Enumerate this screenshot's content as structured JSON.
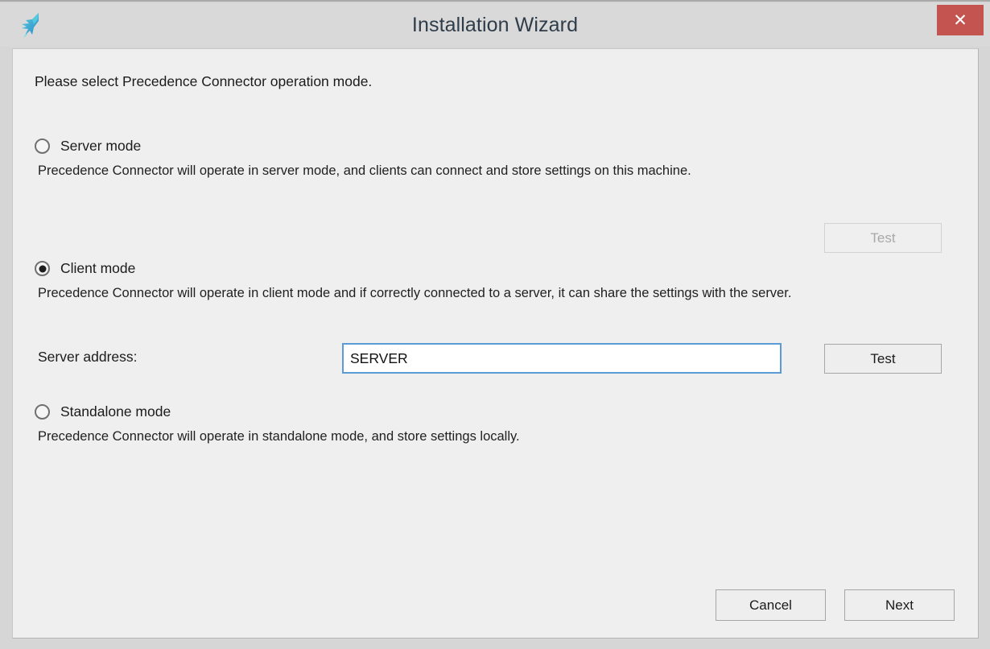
{
  "window": {
    "title": "Installation Wizard",
    "logo_icon": "hummingbird-logo-icon",
    "close_label": "✕",
    "accent_close_color": "#c4544f",
    "focus_border_color": "#5b9bd5",
    "frame_color": "#d6d6d6",
    "panel_color": "#efefef"
  },
  "content": {
    "intro": "Please select Precedence Connector operation mode."
  },
  "options": [
    {
      "id": "server",
      "label": "Server mode",
      "selected": false,
      "description": "Precedence Connector will operate in server mode, and clients can connect and store settings on this machine."
    },
    {
      "id": "client",
      "label": "Client mode",
      "selected": true,
      "description": "Precedence Connector will operate in client mode and if correctly connected to a server, it can share the settings with the server."
    },
    {
      "id": "standalone",
      "label": "Standalone mode",
      "selected": false,
      "description": "Precedence Connector will operate in standalone mode, and store settings locally."
    }
  ],
  "server_test": {
    "label": "Test",
    "enabled": false
  },
  "client_section": {
    "address_label": "Server address:",
    "address_value": "SERVER",
    "address_placeholder": "",
    "test_label": "Test",
    "test_enabled": true
  },
  "footer": {
    "cancel_label": "Cancel",
    "next_label": "Next"
  }
}
